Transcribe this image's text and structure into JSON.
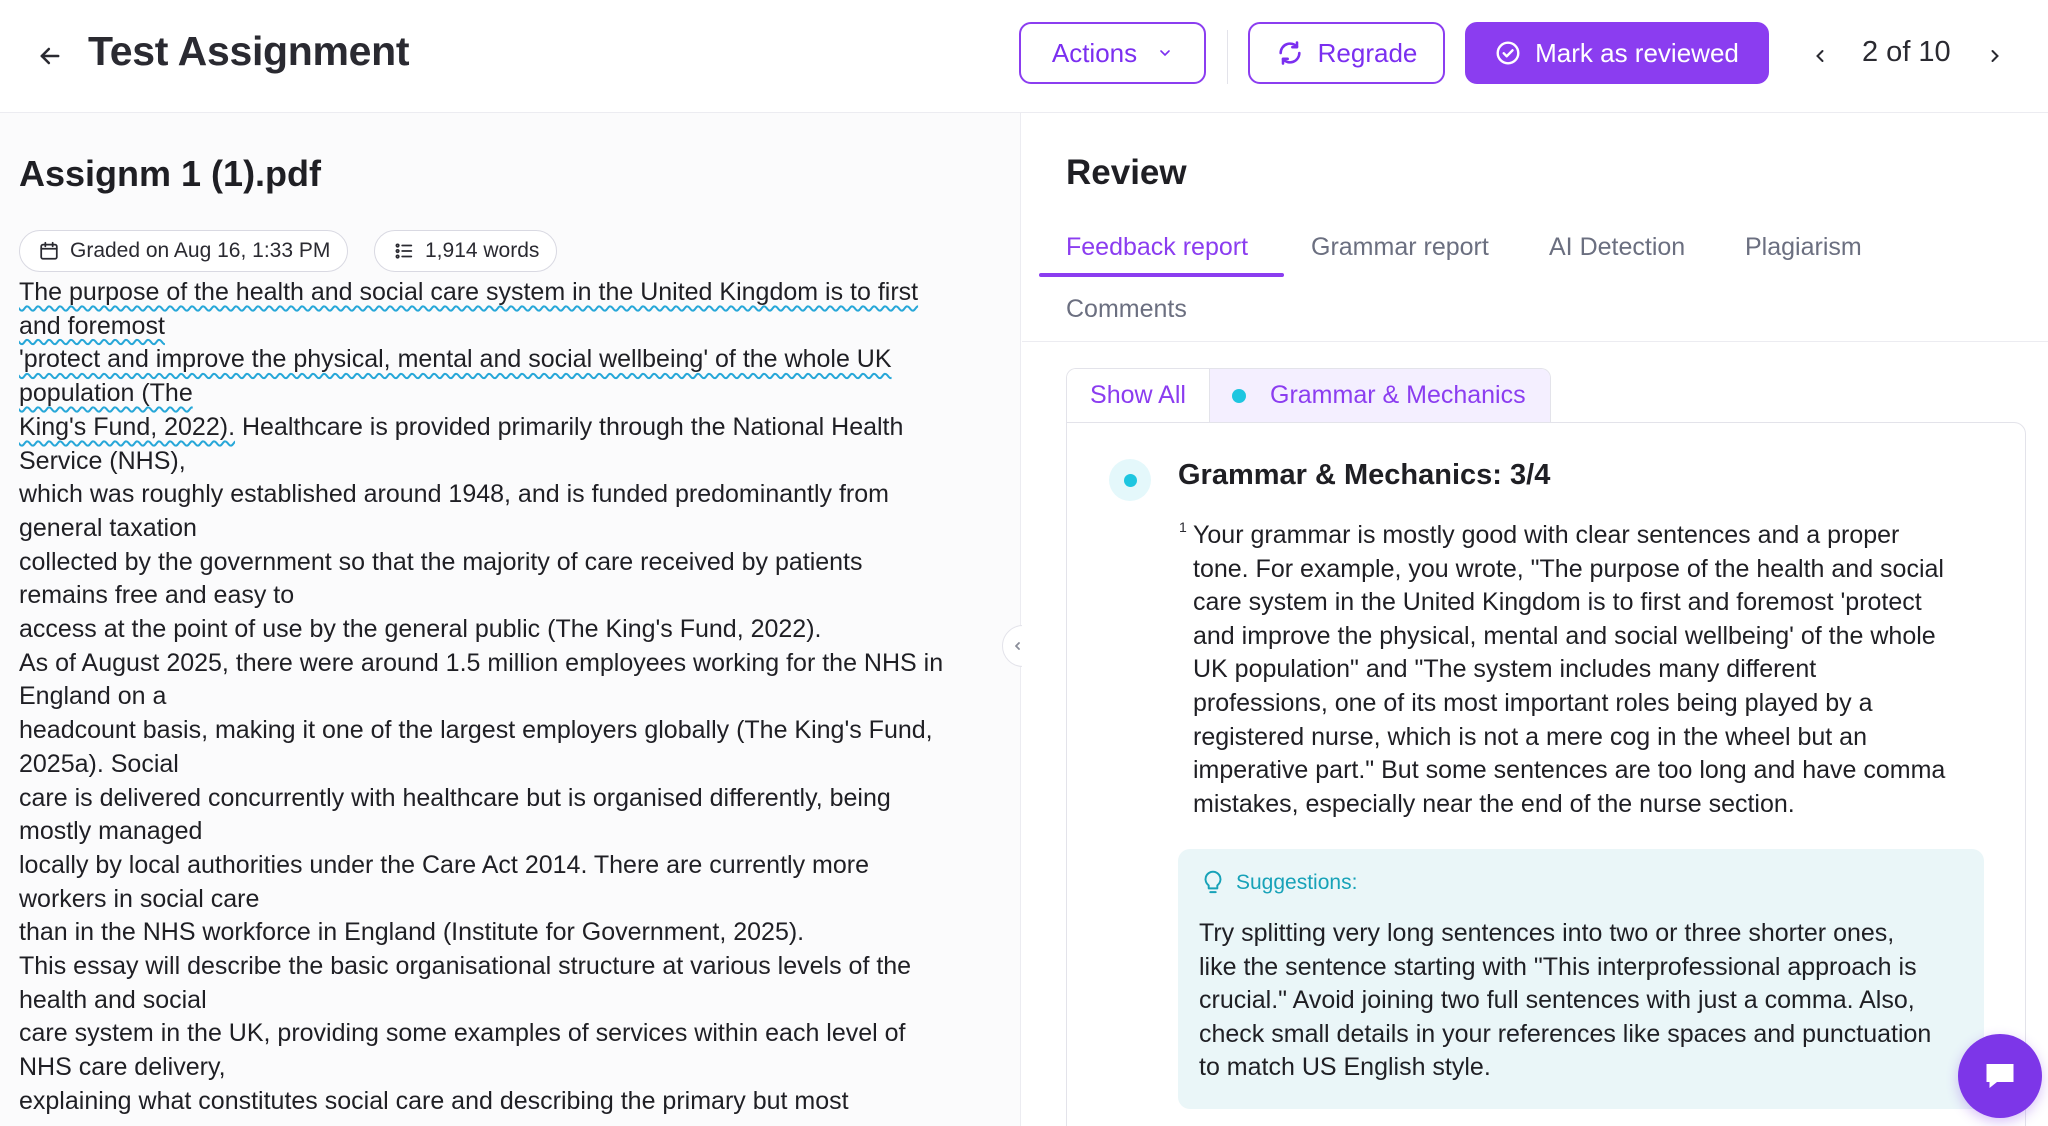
{
  "header": {
    "title": "Test Assignment",
    "actions_label": "Actions",
    "regrade_label": "Regrade",
    "review_label": "Mark as reviewed",
    "pager": "2 of 10"
  },
  "document": {
    "title": "Assignm 1 (1).pdf",
    "graded_on": "Graded on Aug 16, 1:33 PM",
    "word_count": "1,914 words",
    "lines": [
      {
        "a": "The purpose of the health and social care system in the United Kingdom is to first",
        "b": ""
      },
      {
        "a": "and foremost",
        "b": ""
      },
      {
        "a": "'protect and improve the physical, mental and social wellbeing' of the whole UK",
        "b": ""
      },
      {
        "a": "population (The",
        "b": ""
      },
      {
        "a": "King's Fund, 2022).",
        "b": " Healthcare is provided primarily through the National Health"
      },
      {
        "a": "",
        "b": "Service (NHS),"
      },
      {
        "a": "",
        "b": "which was roughly established around 1948, and is funded predominantly from"
      },
      {
        "a": "",
        "b": "general taxation"
      },
      {
        "a": "",
        "b": "collected by the government so that the majority of care received by patients"
      },
      {
        "a": "",
        "b": "remains free and easy to"
      },
      {
        "a": "",
        "b": "access at the point of use by the general public (The King's Fund, 2022)."
      },
      {
        "a": "",
        "b": "As of August 2025, there were around 1.5 million employees working for the NHS in"
      },
      {
        "a": "",
        "b": "England on a"
      },
      {
        "a": "",
        "b": "headcount basis, making it one of the largest employers globally (The King's Fund,"
      },
      {
        "a": "",
        "b": "2025a). Social"
      },
      {
        "a": "",
        "b": "care is delivered concurrently with healthcare but is organised differently, being"
      },
      {
        "a": "",
        "b": "mostly managed"
      },
      {
        "a": "",
        "b": "locally by local authorities under the Care Act 2014. There are currently more"
      },
      {
        "a": "",
        "b": "workers in social care"
      },
      {
        "a": "",
        "b": "than in the NHS workforce in England (Institute for Government, 2025)."
      },
      {
        "a": "",
        "b": "This essay will describe the basic organisational structure at various levels of the"
      },
      {
        "a": "",
        "b": "health and social"
      },
      {
        "a": "",
        "b": "care system in the UK, providing some examples of services within each level of"
      },
      {
        "a": "",
        "b": "NHS care delivery,"
      },
      {
        "a": "",
        "b": "explaining what constitutes social care and describing the primary but most"
      }
    ]
  },
  "review": {
    "title": "Review",
    "tabs": [
      "Feedback report",
      "Grammar report",
      "AI Detection",
      "Plagiarism",
      "Comments"
    ],
    "filters": {
      "all": "Show All",
      "category": "Grammar & Mechanics"
    },
    "card": {
      "title": "Grammar & Mechanics: 3/4",
      "footnote": "1",
      "feedback_lines": [
        "Your grammar is mostly good with clear sentences and a proper",
        "tone. For example, you wrote, \"The purpose of the health and social",
        "care system in the United Kingdom is to first and foremost 'protect",
        "and improve the physical, mental and social wellbeing' of the whole",
        "UK population\" and \"The system includes many different",
        "professions, one of its most important roles being played by a",
        "registered nurse, which is not a mere cog in the wheel but an",
        "imperative part.\" But some sentences are too long and have comma",
        "mistakes, especially near the end of the nurse section."
      ],
      "suggestions_label": "Suggestions:",
      "suggestion_lines": [
        "Try splitting very long sentences into two or three shorter ones,",
        "like the sentence starting with \"This interprofessional approach is",
        "crucial.\" Avoid joining two full sentences with just a comma. Also,",
        "check small details in your references like spaces and punctuation",
        "to match US English style."
      ]
    }
  },
  "colors": {
    "accent": "#8b3df0",
    "cyan": "#1ec6e0",
    "suggest_bg": "#eaf6f8"
  },
  "icons": [
    "arrow-left-icon",
    "chevron-down-icon",
    "refresh-icon",
    "check-circle-icon",
    "chevron-left-icon",
    "chevron-right-icon",
    "calendar-icon",
    "list-icon",
    "resize-handle-icon",
    "lightbulb-icon",
    "chat-icon"
  ]
}
